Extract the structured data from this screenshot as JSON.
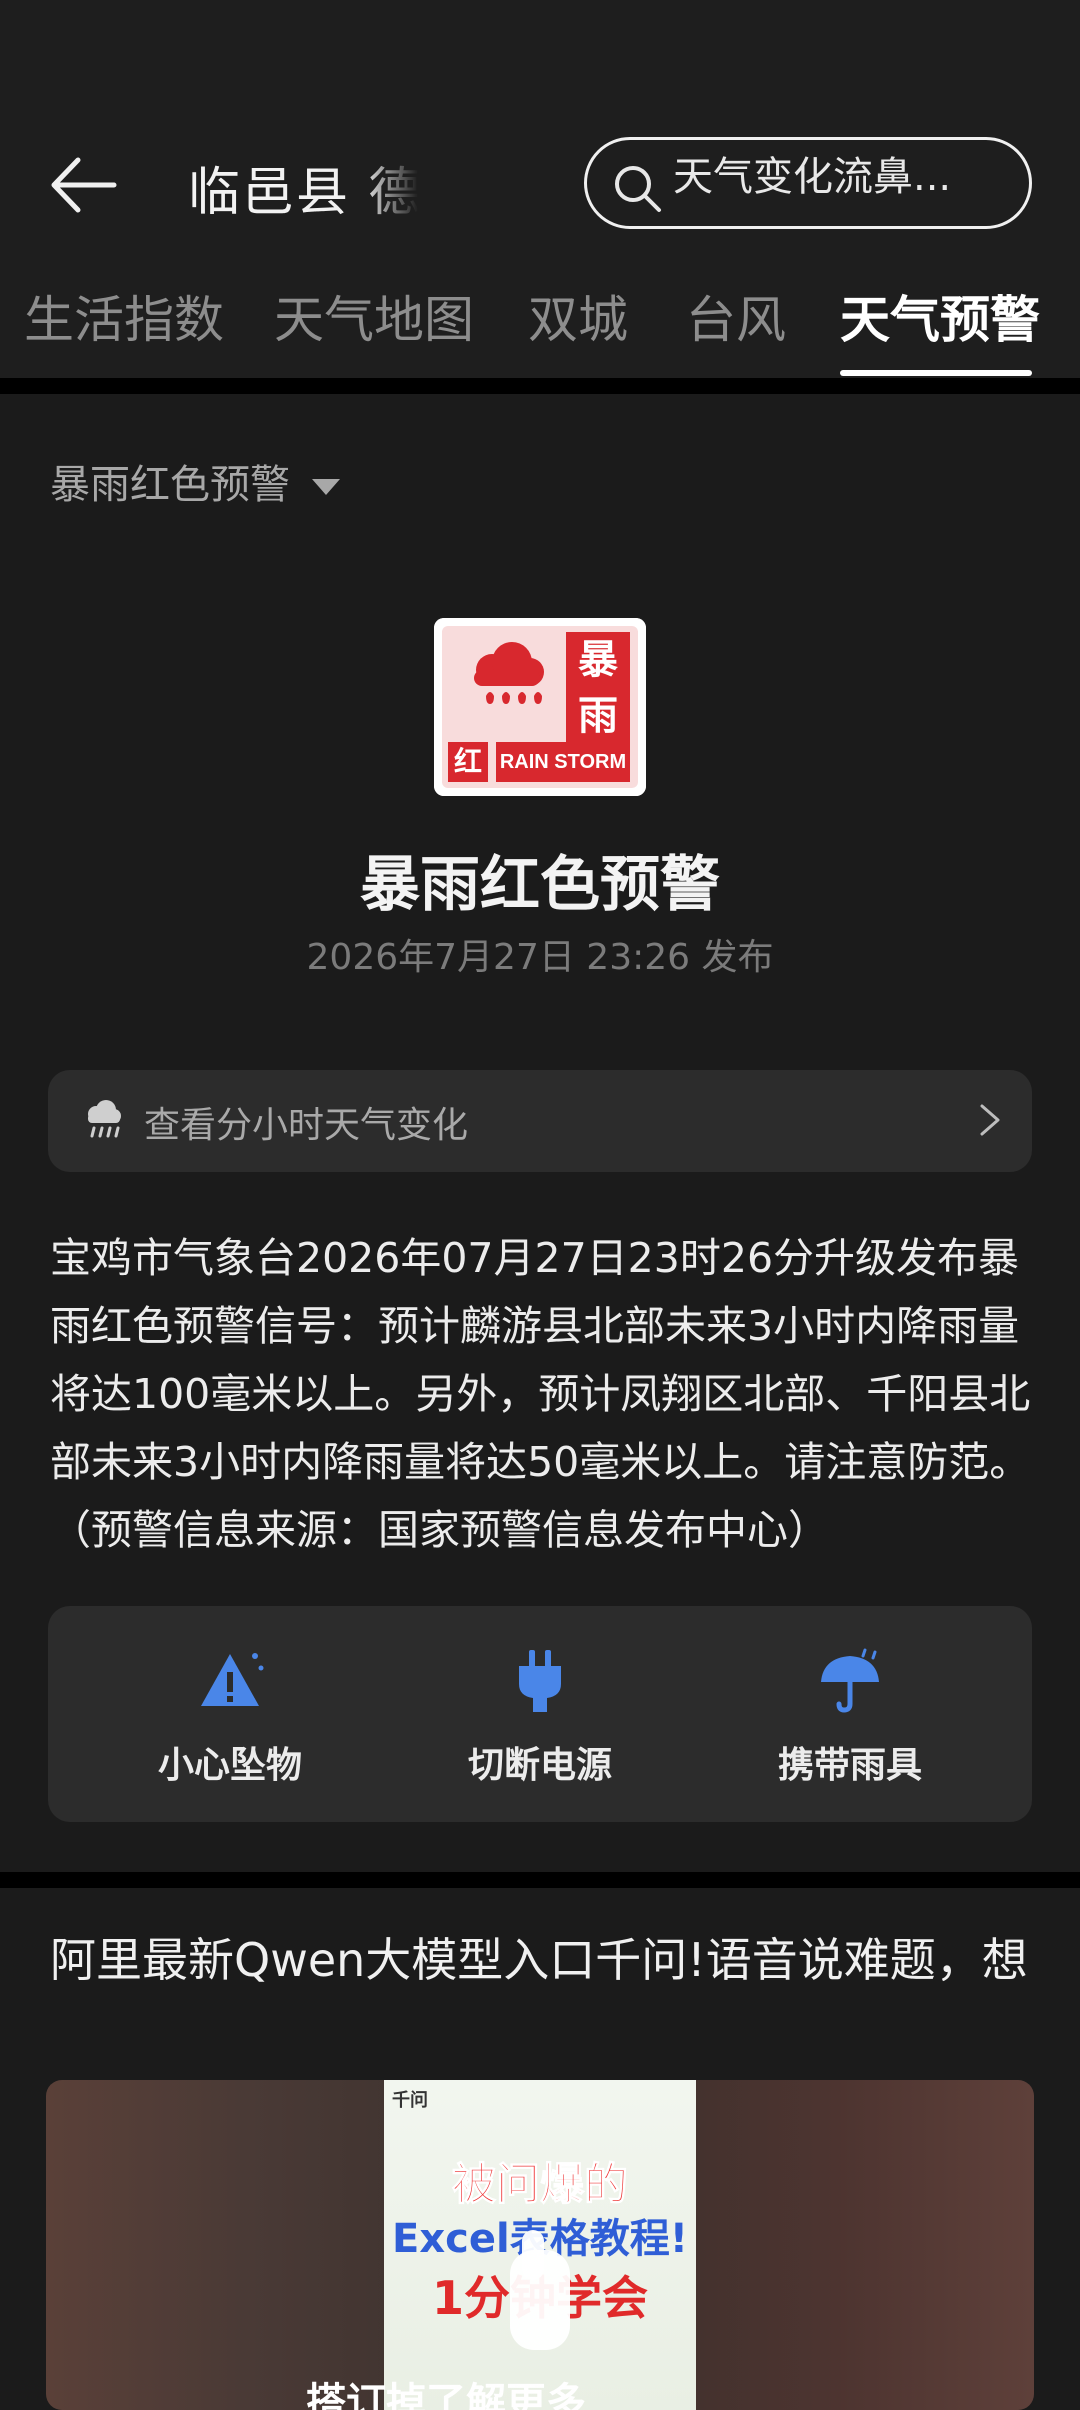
{
  "header": {
    "location_title": "临邑县 德",
    "search_placeholder": "天气变化流鼻..."
  },
  "tabs": [
    {
      "label": "生活指数",
      "active": false
    },
    {
      "label": "天气地图",
      "active": false
    },
    {
      "label": "双城",
      "active": false
    },
    {
      "label": "台风",
      "active": false
    },
    {
      "label": "天气预警",
      "active": true
    }
  ],
  "warning": {
    "dropdown_label": "暴雨红色预警",
    "badge_top_right": "暴雨",
    "badge_level_char": "红",
    "badge_english": "RAIN STORM",
    "title": "暴雨红色预警",
    "published": "2026年7月27日 23:26 发布",
    "hourly_link": "查看分小时天气变化",
    "description": "宝鸡市气象台2026年07月27日23时26分升级发布暴雨红色预警信号：预计麟游县北部未来3小时内降雨量将达100毫米以上。另外，预计凤翔区北部、千阳县北部未来3小时内降雨量将达50毫米以上。请注意防范。（预警信息来源：国家预警信息发布中心）",
    "tips": [
      {
        "label": "小心坠物",
        "icon": "warning-triangle-icon"
      },
      {
        "label": "切断电源",
        "icon": "plug-icon"
      },
      {
        "label": "携带雨具",
        "icon": "umbrella-icon"
      }
    ]
  },
  "article": {
    "title": "阿里最新Qwen大模型入口千问!语音说难题，想",
    "thumbnail": {
      "app_name": "千问",
      "line1": "被问爆的",
      "line2": "Excel表格教程!",
      "line3": "1分钟学会",
      "caption": "搭订掉了解更多"
    }
  },
  "colors": {
    "background": "#1b1b1b",
    "card": "#2c2c2c",
    "accent_blue": "#4a86e8",
    "warning_red": "#d8282e"
  }
}
